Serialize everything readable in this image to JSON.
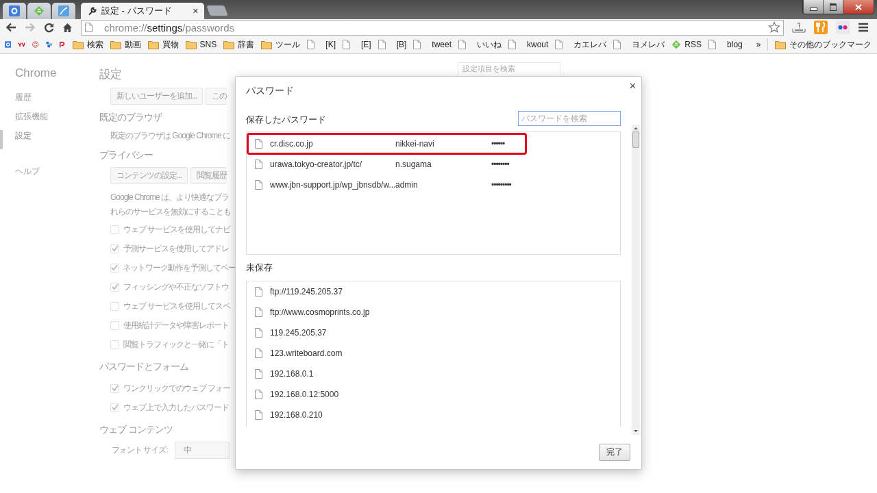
{
  "browser": {
    "tabs": [
      {
        "selected": false
      },
      {
        "selected": false
      },
      {
        "selected": false
      },
      {
        "title": "設定 - パスワード",
        "close": "✕",
        "selected": true
      }
    ],
    "nav_buttons": [
      {
        "kind": "back",
        "disabled": false
      },
      {
        "kind": "forward",
        "disabled": true
      },
      {
        "kind": "reload",
        "disabled": false
      },
      {
        "kind": "home",
        "disabled": false
      }
    ],
    "address": {
      "scheme": "chrome://",
      "host": "settings",
      "path": "/passwords"
    },
    "bookmarks": [
      {
        "kind": "favicon"
      },
      {
        "kind": "favicon"
      },
      {
        "kind": "favicon"
      },
      {
        "kind": "favicon"
      },
      {
        "kind": "favicon"
      },
      {
        "kind": "folder",
        "label": "検索"
      },
      {
        "kind": "folder",
        "label": "動画"
      },
      {
        "kind": "folder",
        "label": "買物"
      },
      {
        "kind": "folder",
        "label": "SNS"
      },
      {
        "kind": "folder",
        "label": "辞書"
      },
      {
        "kind": "folder",
        "label": "ツール"
      },
      {
        "kind": "page",
        "label": "[K]"
      },
      {
        "kind": "page",
        "label": "[E]"
      },
      {
        "kind": "page",
        "label": "[B]"
      },
      {
        "kind": "page",
        "label": "tweet"
      },
      {
        "kind": "page",
        "label": "いいね"
      },
      {
        "kind": "page",
        "label": "kwout"
      },
      {
        "kind": "page",
        "label": "カエレバ"
      },
      {
        "kind": "page",
        "label": "ヨメレバ"
      },
      {
        "kind": "feed",
        "label": "RSS"
      },
      {
        "kind": "page",
        "label": "blog"
      }
    ],
    "bookmarks_overflow": "»",
    "other_bookmarks": "その他のブックマーク"
  },
  "settings_page": {
    "brand": "Chrome",
    "nav": [
      {
        "label": "履歴",
        "selected": false
      },
      {
        "label": "拡張機能",
        "selected": false
      },
      {
        "label": "設定",
        "selected": true
      },
      {
        "label": "ヘルプ",
        "selected": false
      }
    ],
    "title": "設定",
    "search_placeholder": "設定項目を検索",
    "blocks": [
      {
        "kind": "buttons",
        "buttons": [
          "新しいユーザーを追加...",
          "この"
        ]
      },
      {
        "kind": "heading",
        "text": "既定のブラウザ"
      },
      {
        "kind": "text",
        "text": "既定のブラウザは Google Chrome に"
      },
      {
        "kind": "heading",
        "text": "プライバシー"
      },
      {
        "kind": "buttons",
        "buttons": [
          "コンテンツの設定...",
          "閲覧履歴"
        ]
      },
      {
        "kind": "text",
        "text": "Google Chrome は、より快適なブラ"
      },
      {
        "kind": "text",
        "text": "れらのサービスを無効にすることも"
      },
      {
        "kind": "checkbox",
        "label": "ウェブ サービスを使用してナビ",
        "checked": false
      },
      {
        "kind": "checkbox",
        "label": "予測サービスを使用してアドレ",
        "checked": true
      },
      {
        "kind": "checkbox",
        "label": "ネットワーク動作を予測してペー",
        "checked": true
      },
      {
        "kind": "checkbox",
        "label": "フィッシングや不正なソフトウ",
        "checked": true
      },
      {
        "kind": "checkbox",
        "label": "ウェブ サービスを使用してスペ",
        "checked": false
      },
      {
        "kind": "checkbox",
        "label": "使用統計データや障害レポート",
        "checked": false
      },
      {
        "kind": "checkbox",
        "label": "閲覧トラフィックと一緒に「ト",
        "checked": false
      },
      {
        "kind": "heading",
        "text": "パスワードとフォーム"
      },
      {
        "kind": "checkbox",
        "label": "ワンクリックでのウェブ フォー",
        "checked": true
      },
      {
        "kind": "checkbox",
        "label": "ウェブ上で入力したパスワード",
        "checked": true
      },
      {
        "kind": "heading",
        "text": "ウェブ コンテンツ"
      },
      {
        "kind": "select",
        "label": "フォント サイズ:",
        "value": "中"
      }
    ]
  },
  "dialog": {
    "title": "パスワード",
    "close": "✕",
    "saved_heading": "保存したパスワード",
    "search_placeholder": "パスワードを検索",
    "saved": [
      {
        "site": "cr.disc.co.jp",
        "user": "nikkei-navi",
        "password": "••••••",
        "highlighted": true
      },
      {
        "site": "urawa.tokyo-creator.jp/tc/",
        "user": "n.sugama",
        "password": "••••••••",
        "highlighted": false
      },
      {
        "site": "www.jbn-support.jp/wp_jbnsdb/w...",
        "user": "admin",
        "password": "•••••••••",
        "highlighted": false
      }
    ],
    "unsaved_heading": "未保存",
    "unsaved": [
      "ftp://119.245.205.37",
      "ftp://www.cosmoprints.co.jp",
      "119.245.205.37",
      "123.writeboard.com",
      "192.168.0.1",
      "192.168.0.12:5000",
      "192.168.0.210"
    ],
    "done": "完了"
  }
}
